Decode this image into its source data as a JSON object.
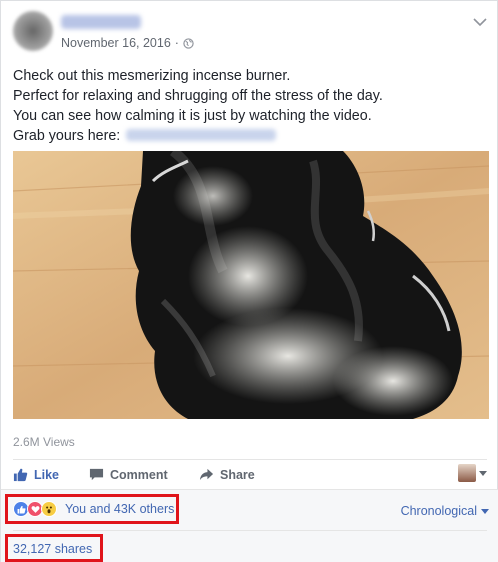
{
  "post": {
    "date": "November 16, 2016",
    "separator": "·",
    "lines": [
      "Check out this mesmerizing incense burner.",
      "Perfect for relaxing and shrugging off the stress of the day.",
      "You can see how calming it is just by watching the video.",
      "Grab yours here:"
    ]
  },
  "video": {
    "views": "2.6M Views"
  },
  "actions": {
    "like": "Like",
    "comment": "Comment",
    "share": "Share"
  },
  "icons": {
    "privacy": "globe-icon",
    "options": "chevron-down-icon",
    "like": "thumbs-up-icon",
    "comment": "speech-bubble-icon",
    "share": "share-arrow-icon"
  },
  "reactions": {
    "summary": "You and 43K others",
    "types": [
      "like",
      "love",
      "wow"
    ]
  },
  "comments": {
    "sort": "Chronological"
  },
  "shares": {
    "count": "32,127 shares"
  },
  "colors": {
    "link": "#4267b2",
    "highlight_box": "#e0141b",
    "meta": "#616770"
  }
}
